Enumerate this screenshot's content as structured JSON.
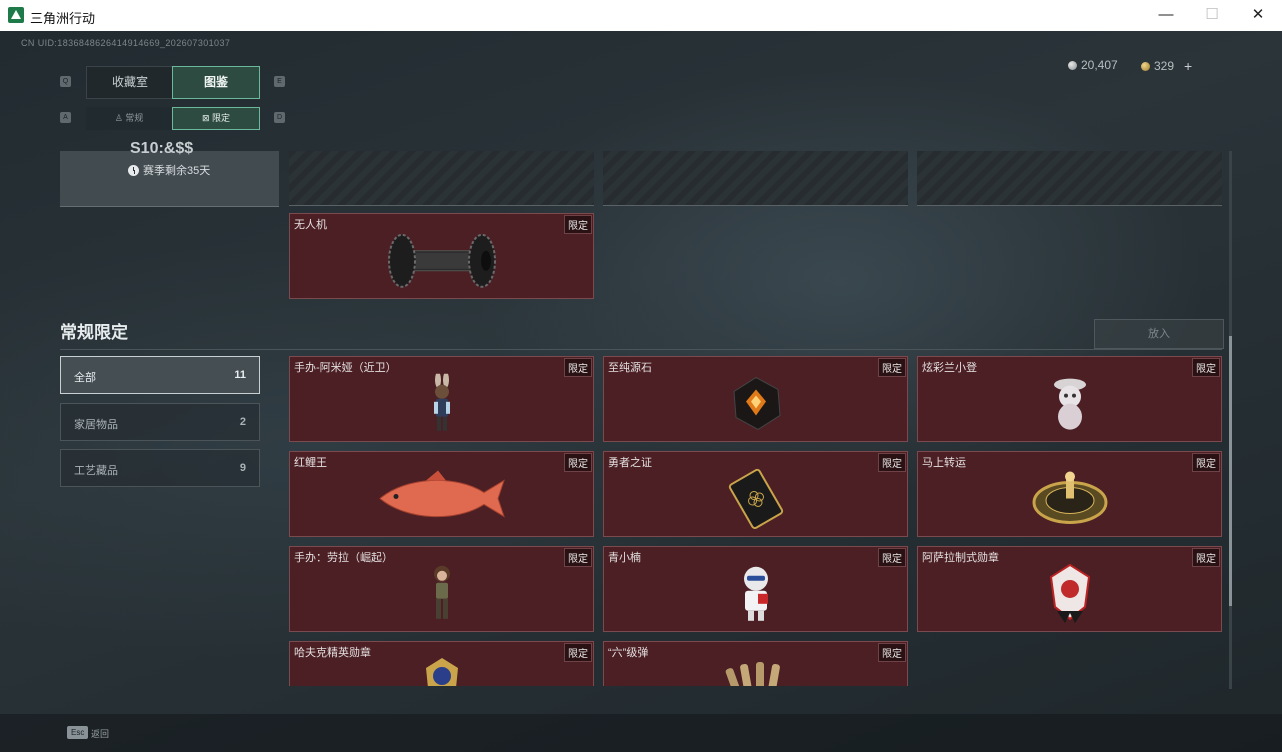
{
  "window": {
    "title": "三角洲行动",
    "controls": {
      "minimize": "—",
      "maximize": "☐",
      "close": "✕"
    }
  },
  "header": {
    "uid": "CN UID:1836848626414914669_202607301037",
    "currency": [
      {
        "icon": "silver-coin-icon",
        "value": "20,407"
      },
      {
        "icon": "gold-coin-icon",
        "value": "329"
      }
    ],
    "add_label": "+"
  },
  "tabs": {
    "main": [
      {
        "label": "收藏室",
        "key": "Q",
        "active": false
      },
      {
        "label": "图鉴",
        "key": "E",
        "active": true
      }
    ],
    "sub": [
      {
        "label": "常规",
        "key": "A",
        "icon": "figure-icon",
        "active": false
      },
      {
        "label": "限定",
        "key": "D",
        "icon": "limited-icon",
        "active": true
      }
    ]
  },
  "season_panel": {
    "title": "S10:&$$",
    "remaining": "赛季剩余35天"
  },
  "top_items": [
    {
      "name": "无人机",
      "tag": "限定",
      "icon": "drone-rotor-icon"
    }
  ],
  "section": {
    "title": "常规限定",
    "put_button": "放入"
  },
  "categories": [
    {
      "label": "全部",
      "count": "11",
      "active": true
    },
    {
      "label": "家居物品",
      "count": "2",
      "active": false
    },
    {
      "label": "工艺藏品",
      "count": "9",
      "active": false
    }
  ],
  "items": [
    {
      "name": "手办-阿米娅（近卫）",
      "tag": "限定",
      "icon": "figure-amiya-icon"
    },
    {
      "name": "至纯源石",
      "tag": "限定",
      "icon": "originium-crystal-icon"
    },
    {
      "name": "炫彩兰小登",
      "tag": "限定",
      "icon": "mascot-figure-icon"
    },
    {
      "name": "红鲤王",
      "tag": "限定",
      "icon": "red-carp-icon"
    },
    {
      "name": "勇者之证",
      "tag": "限定",
      "icon": "card-emblem-icon"
    },
    {
      "name": "马上转运",
      "tag": "限定",
      "icon": "golden-wheel-icon"
    },
    {
      "name": "手办：劳拉（崛起）",
      "tag": "限定",
      "icon": "figure-lara-icon"
    },
    {
      "name": "青小楠",
      "tag": "限定",
      "icon": "chibi-figure-icon"
    },
    {
      "name": "阿萨拉制式勋章",
      "tag": "限定",
      "icon": "medal-icon"
    },
    {
      "name": "哈夫克精英勋章",
      "tag": "限定",
      "icon": "elite-medal-icon"
    },
    {
      "name": "“六”级弹",
      "tag": "限定",
      "icon": "bullets-icon"
    }
  ],
  "footer": {
    "esc_key": "Esc",
    "back_label": "返回"
  },
  "colors": {
    "card_bg": "#4b1f24",
    "accent": "#6cb89a",
    "tab_active_bg": "#2e4b42"
  }
}
